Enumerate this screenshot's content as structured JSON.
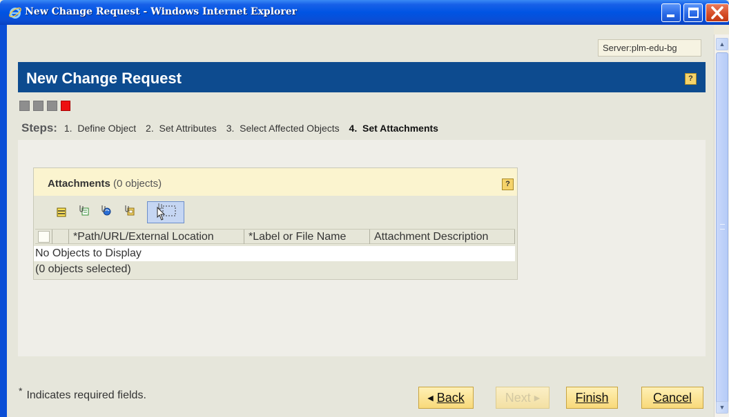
{
  "window": {
    "title": "New Change Request - Windows Internet Explorer",
    "server": "Server:plm-edu-bg"
  },
  "header": {
    "title": "New Change Request",
    "help": "?"
  },
  "progress": {
    "total_steps": 4,
    "current_step": 4
  },
  "steps": {
    "label": "Steps:",
    "items": [
      {
        "num": "1.",
        "label": "Define Object"
      },
      {
        "num": "2.",
        "label": "Set Attributes"
      },
      {
        "num": "3.",
        "label": "Select Affected Objects"
      },
      {
        "num": "4.",
        "label": "Set Attachments"
      }
    ]
  },
  "attachments": {
    "title": "Attachments",
    "count": "(0 objects)",
    "help": "?",
    "toolbar": [
      "select-all-icon",
      "add-file-icon",
      "add-url-icon",
      "add-external-icon",
      "drag-drop-icon"
    ],
    "columns": [
      "*Path/URL/External Location",
      "*Label or File Name",
      "Attachment Description"
    ],
    "empty_text": "No Objects to Display",
    "selected_text": "(0 objects selected)"
  },
  "footer": {
    "required_star": "*",
    "required_note": "Indicates required fields.",
    "buttons": {
      "back": "Back",
      "next": "Next",
      "finish": "Finish",
      "cancel": "Cancel"
    }
  },
  "colors": {
    "header_bg": "#0D4B8F",
    "active_step": "#EE1010",
    "button_bg": "#F8D97A"
  }
}
